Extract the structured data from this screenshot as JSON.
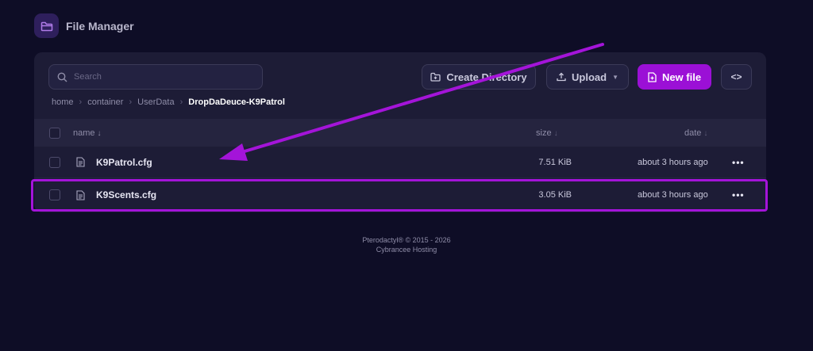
{
  "app": {
    "title": "File Manager",
    "icon": "folder-icon"
  },
  "search": {
    "placeholder": "Search",
    "value": ""
  },
  "breadcrumb": {
    "items": [
      "home",
      "container",
      "UserData"
    ],
    "current": "DropDaDeuce-K9Patrol"
  },
  "toolbar": {
    "create_directory_label": "Create Directory",
    "upload_label": "Upload",
    "new_file_label": "New file",
    "code_toggle_label": "<>"
  },
  "table": {
    "columns": {
      "name": "name",
      "size": "size",
      "date": "date"
    },
    "sort_indicator": "↓",
    "rows": [
      {
        "name": "K9Patrol.cfg",
        "size": "7.51 KiB",
        "date": "about 3 hours ago",
        "more": "•••"
      },
      {
        "name": "K9Scents.cfg",
        "size": "3.05 KiB",
        "date": "about 3 hours ago",
        "more": "•••"
      }
    ]
  },
  "footer": {
    "line1": "Pterodactyl® © 2015 - 2026",
    "line2": "Cybrancee Hosting"
  },
  "colors": {
    "background": "#0e0d26",
    "panel": "#1d1c36",
    "accent": "#9b10d6",
    "annotation": "#a414d9"
  }
}
